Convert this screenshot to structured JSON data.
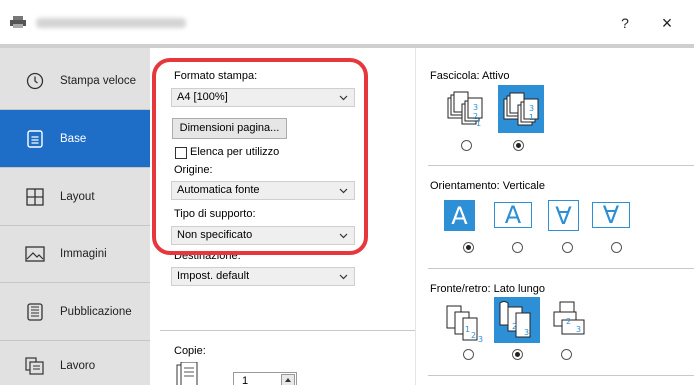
{
  "window": {
    "title_blurred": true,
    "help_label": "?",
    "close_label": "×"
  },
  "sidebar": {
    "items": [
      {
        "label": "Stampa veloce",
        "icon": "clock-icon",
        "active": false
      },
      {
        "label": "Base",
        "icon": "document-icon",
        "active": true
      },
      {
        "label": "Layout",
        "icon": "layout-grid-icon",
        "active": false
      },
      {
        "label": "Immagini",
        "icon": "image-icon",
        "active": false
      },
      {
        "label": "Pubblicazione",
        "icon": "publication-icon",
        "active": false
      },
      {
        "label": "Lavoro",
        "icon": "job-icon",
        "active": false
      }
    ]
  },
  "basic": {
    "formato_label": "Formato stampa:",
    "formato_value": "A4  [100%]",
    "dimensioni_button": "Dimensioni pagina...",
    "elenca_label": "Elenca per utilizzo",
    "elenca_checked": false,
    "origine_label": "Origine:",
    "origine_value": "Automatica fonte",
    "tipo_label": "Tipo di supporto:",
    "tipo_value": "Non specificato",
    "destinazione_label": "Destinazione:",
    "destinazione_value": "Impost. default",
    "copie_label": "Copie:",
    "copie_value": "1"
  },
  "right": {
    "fascicola_label": "Fascicola:",
    "fascicola_value": "Attivo",
    "fascicola_selected": 1,
    "orientamento_label": "Orientamento:",
    "orientamento_value": "Verticale",
    "orientamento_selected": 0,
    "orient_glyphs": [
      "A",
      "A",
      "∀",
      "∀"
    ],
    "fronte_label": "Fronte/retro:",
    "fronte_value": "Lato lungo",
    "fronte_selected": 1
  },
  "colors": {
    "accent": "#2d8fd5",
    "sidebar_active": "#1e6ec8",
    "highlight": "#e6373d"
  }
}
